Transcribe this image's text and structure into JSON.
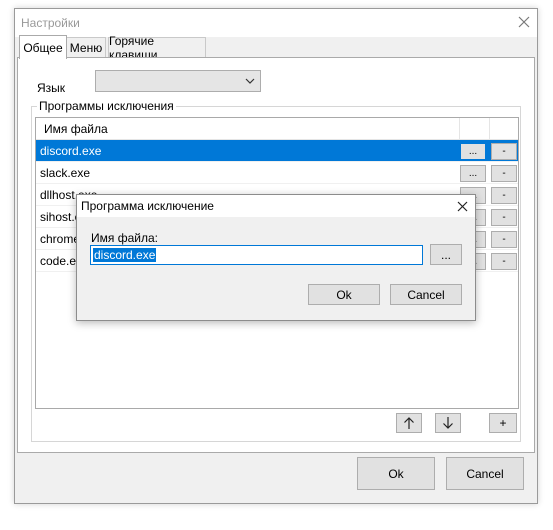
{
  "window": {
    "title": "Настройки"
  },
  "tabs": [
    {
      "label": "Общее",
      "active": true
    },
    {
      "label": "Меню",
      "active": false
    },
    {
      "label": "Горячие клавиши",
      "active": false
    }
  ],
  "language": {
    "label": "Язык",
    "selected": ""
  },
  "exclusions": {
    "group_label": "Программы исключения",
    "column_header": "Имя файла",
    "rows": [
      {
        "file": "discord.exe",
        "selected": true
      },
      {
        "file": "slack.exe",
        "selected": false
      },
      {
        "file": "dllhost.exe",
        "selected": false
      },
      {
        "file": "sihost.exe",
        "selected": false
      },
      {
        "file": "chrome.exe",
        "selected": false
      },
      {
        "file": "code.exe",
        "selected": false
      }
    ],
    "browse_label": "...",
    "remove_label": "-",
    "add_label": "+",
    "up_icon": "arrow-up-icon",
    "down_icon": "arrow-down-icon"
  },
  "footer": {
    "ok_label": "Ok",
    "cancel_label": "Cancel"
  },
  "dialog": {
    "title": "Программа исключение",
    "file_label": "Имя файла:",
    "file_value": "discord.exe",
    "browse_label": "...",
    "ok_label": "Ok",
    "cancel_label": "Cancel"
  },
  "colors": {
    "selection": "#0078d7",
    "window_bg": "#f0f0f0",
    "button_bg": "#e1e1e1"
  }
}
